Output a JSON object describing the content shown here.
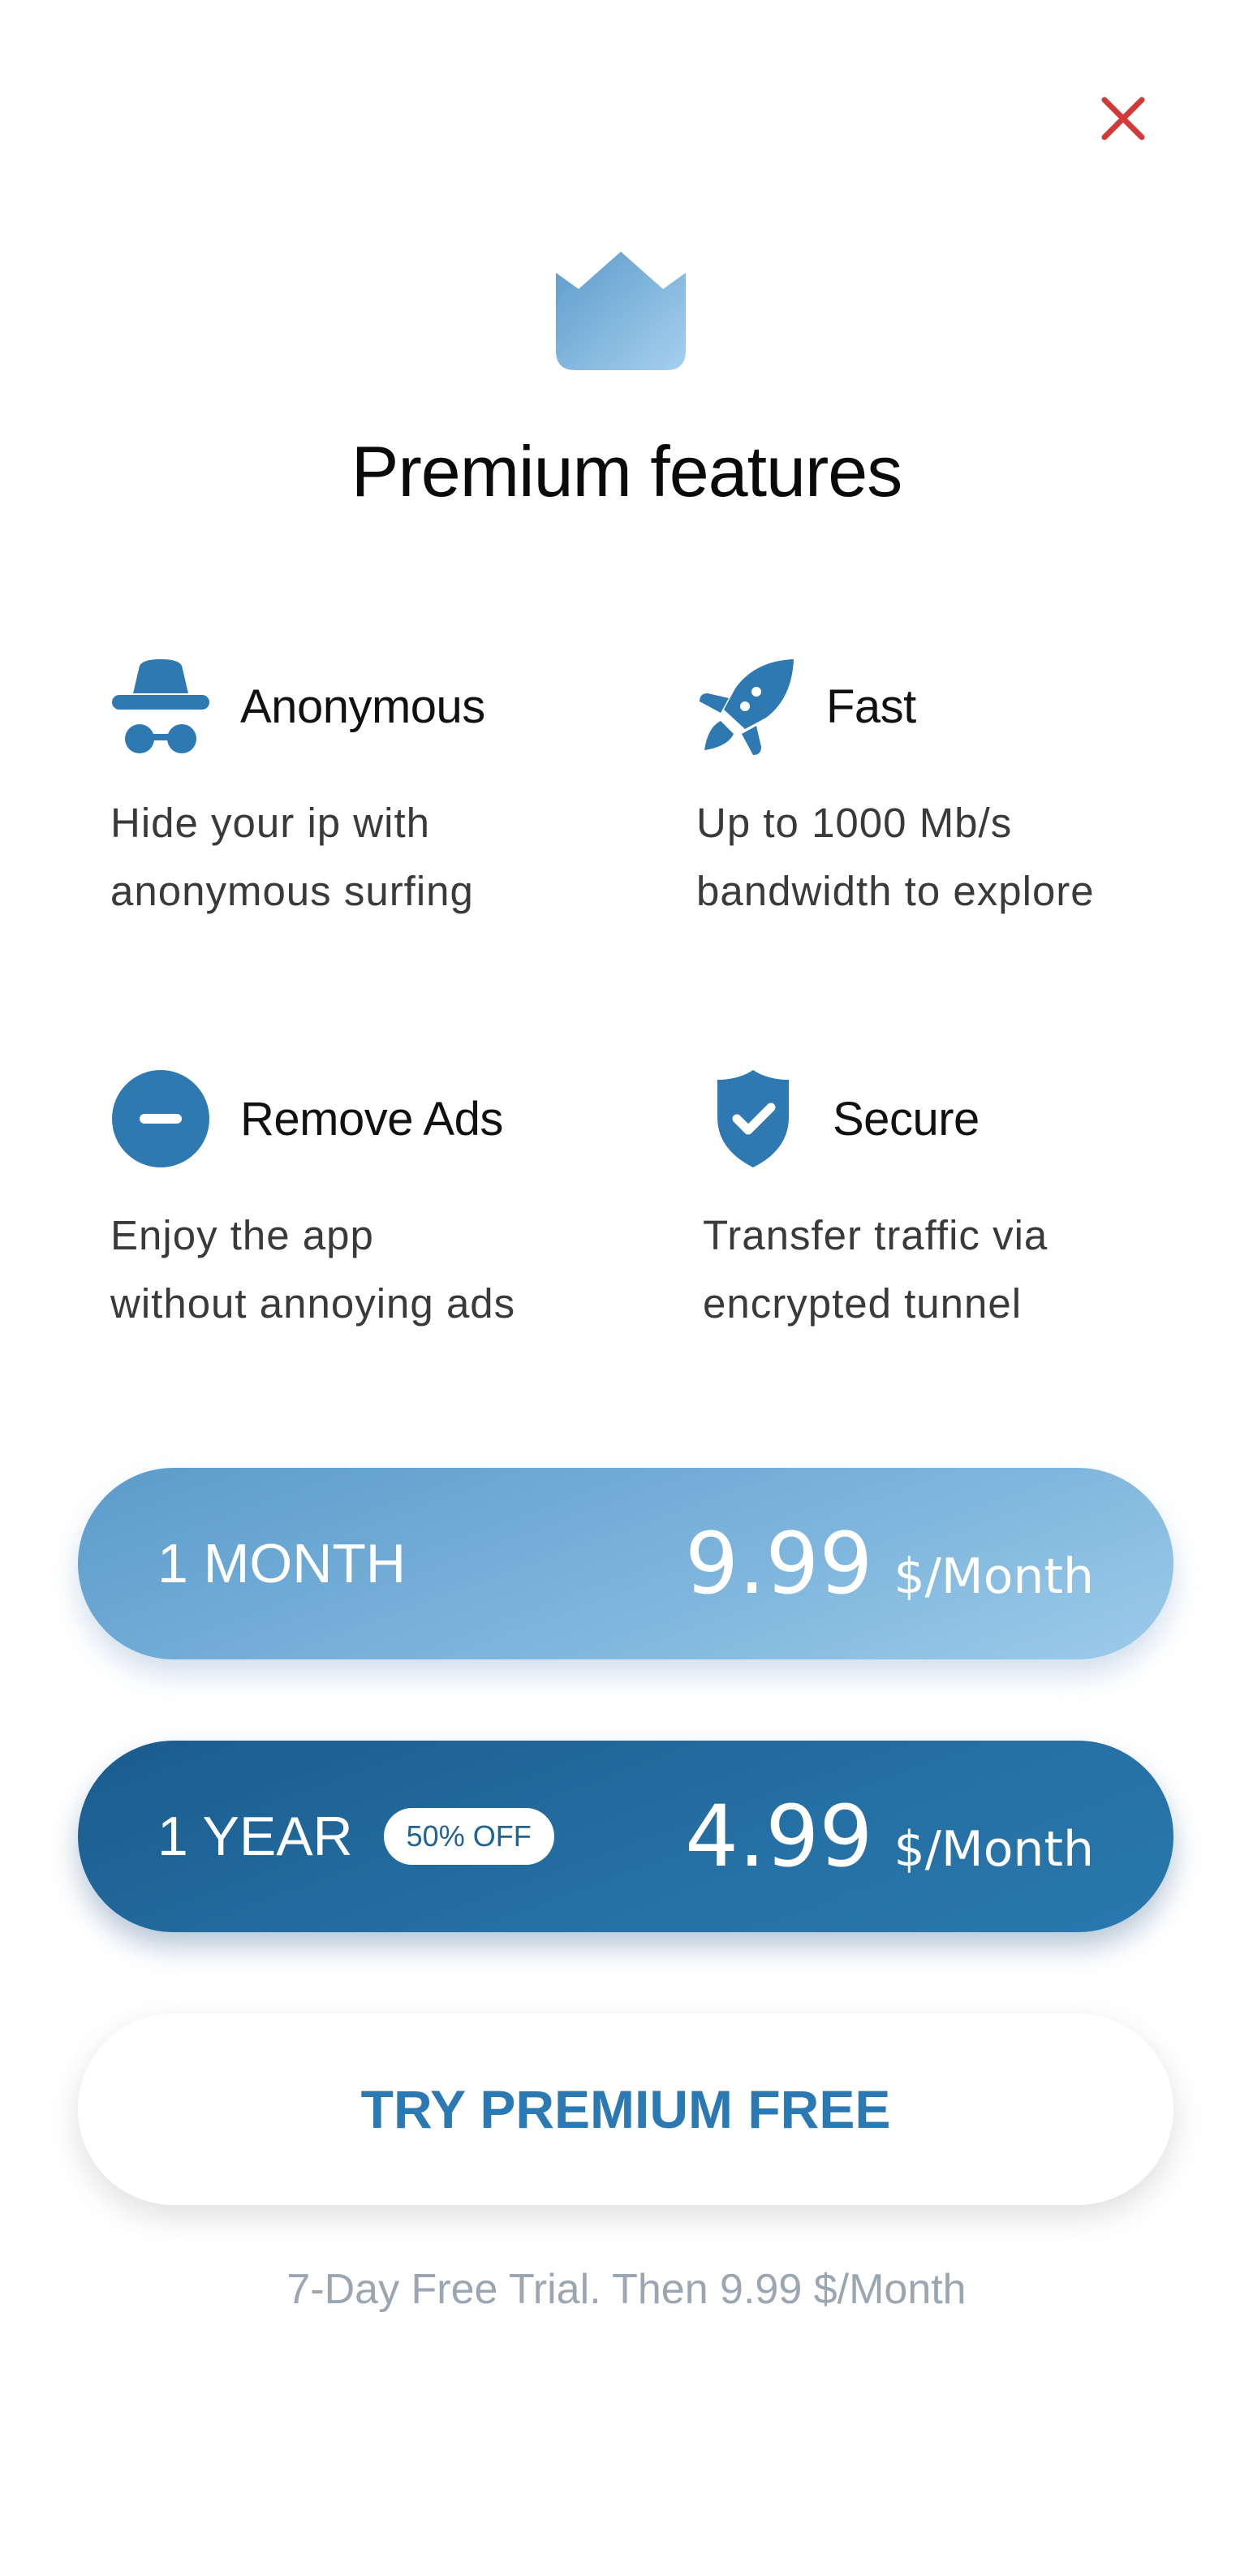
{
  "header": {
    "close_icon": "close-icon",
    "crown_icon": "crown-icon",
    "title": "Premium features"
  },
  "features": [
    {
      "icon": "incognito-icon",
      "title": "Anonymous",
      "description": "Hide your ip with\nanonymous surfing"
    },
    {
      "icon": "rocket-icon",
      "title": "Fast",
      "description": "Up to 1000 Mb/s\nbandwidth to explore"
    },
    {
      "icon": "minus-circle-icon",
      "title": "Remove Ads",
      "description": "Enjoy the app\nwithout annoying ads"
    },
    {
      "icon": "shield-check-icon",
      "title": "Secure",
      "description": "Transfer traffic via\nencrypted tunnel"
    }
  ],
  "plans": [
    {
      "name": "1 MONTH",
      "price": "9.99",
      "unit": "$/Month"
    },
    {
      "name": "1 YEAR",
      "badge": "50% OFF",
      "price": "4.99",
      "unit": "$/Month"
    }
  ],
  "trial": {
    "button_label": "TRY PREMIUM FREE",
    "note": "7-Day Free Trial. Then 9.99 $/Month"
  },
  "colors": {
    "close": "#d23a3a",
    "icon_blue": "#2f79b2",
    "month_plan": "#7fb6dd",
    "year_plan": "#2570a4",
    "try_text": "#2a79b3"
  }
}
